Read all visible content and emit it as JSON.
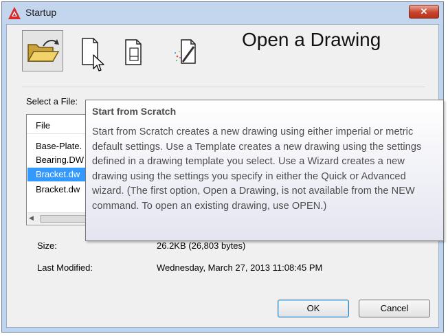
{
  "window": {
    "title": "Startup",
    "close_glyph": "✕"
  },
  "toolbar": {
    "heading": "Open a Drawing",
    "modes": [
      {
        "icon": "open-folder-icon",
        "selected": true
      },
      {
        "icon": "blank-page-icon",
        "selected": false
      },
      {
        "icon": "template-page-icon",
        "selected": false
      },
      {
        "icon": "wizard-icon",
        "selected": false
      }
    ]
  },
  "file_panel": {
    "select_label": "Select a File:",
    "column_header": "File",
    "files": [
      {
        "name": "Base-Plate.",
        "selected": false
      },
      {
        "name": "Bearing.DW",
        "selected": false
      },
      {
        "name": "Bracket.dw",
        "selected": true
      },
      {
        "name": "Bracket.dw",
        "selected": false
      }
    ]
  },
  "details": {
    "size_label": "Size:",
    "size_value": "26.2KB (26,803 bytes)",
    "modified_label": "Last Modified:",
    "modified_value": "Wednesday, March 27, 2013  11:08:45 PM"
  },
  "tooltip": {
    "title": "Start from Scratch",
    "body": "Start from Scratch creates a new drawing using either imperial or metric default settings. Use a Template creates a new drawing using the settings defined in a drawing template you select. Use a Wizard creates a new drawing using the settings you specify in either the Quick or Advanced wizard. (The first option, Open a Drawing, is not available from the NEW command. To open an existing drawing, use OPEN.)"
  },
  "buttons": {
    "ok": "OK",
    "cancel": "Cancel"
  },
  "colors": {
    "selection": "#3399ff",
    "title_bar": "#c4d6ee",
    "close_button": "#c8442b",
    "app_icon": "#d62b2b"
  }
}
